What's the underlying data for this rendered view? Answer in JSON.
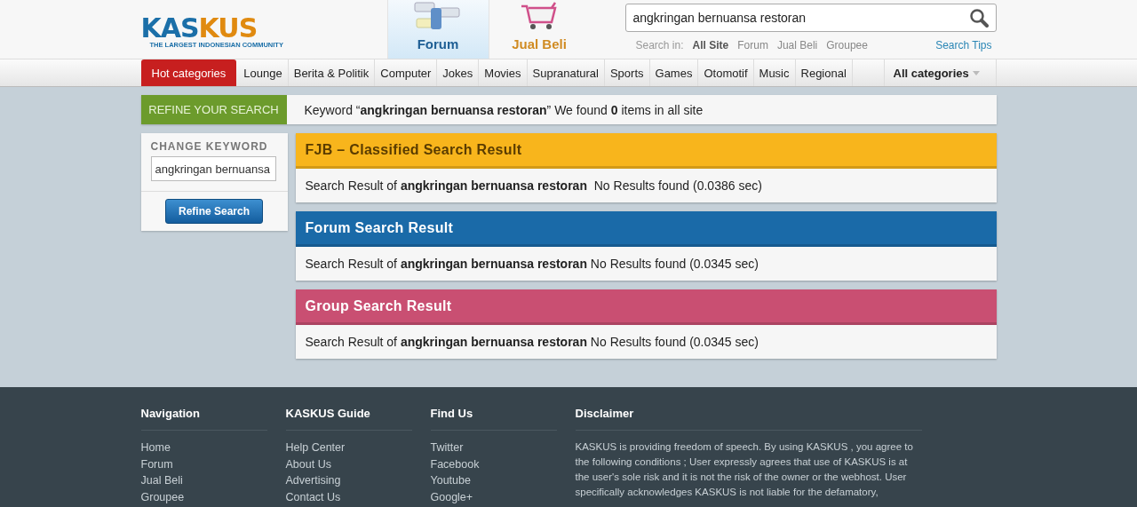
{
  "logo": {
    "name_left": "KAS",
    "name_right": "KUS",
    "tagline": "THE LARGEST INDONESIAN COMMUNITY"
  },
  "sections": [
    {
      "label": "Forum",
      "selected": true,
      "kind": "forum"
    },
    {
      "label": "Jual Beli",
      "selected": false,
      "kind": "cart"
    }
  ],
  "search": {
    "value": "angkringan bernuansa restoran",
    "scope_label": "Search in:",
    "scopes": [
      {
        "label": "All Site",
        "selected": true
      },
      {
        "label": "Forum",
        "selected": false
      },
      {
        "label": "Jual Beli",
        "selected": false
      },
      {
        "label": "Groupee",
        "selected": false
      }
    ],
    "tips": "Search Tips"
  },
  "nav": {
    "hot": "Hot categories",
    "items": [
      "Lounge",
      "Berita & Politik",
      "Computer",
      "Jokes",
      "Movies",
      "Supranatural",
      "Sports",
      "Games",
      "Otomotif",
      "Music",
      "Regional"
    ],
    "all": "All categories"
  },
  "refine": {
    "tab": "REFINE YOUR SEARCH",
    "summary": "Keyword “**angkringan bernuansa restoran**” We found **0** items in all site",
    "change_label": "CHANGE KEYWORD",
    "keyword": "angkringan bernuansa",
    "button": "Refine Search"
  },
  "results": [
    {
      "title": "FJB – Classified Search Result",
      "color": "#f8b51c",
      "text": "Search Result of **angkringan bernuansa restoran**  No Results found (0.0386 sec)"
    },
    {
      "title": "Forum Search Result",
      "color": "#1a6aa8",
      "text": "Search Result of **angkringan bernuansa restoran** No Results found (0.0345 sec)"
    },
    {
      "title": "Group Search Result",
      "color": "#c94f72",
      "text": "Search Result of **angkringan bernuansa restoran** No Results found (0.0345 sec)"
    }
  ],
  "footer": {
    "columns": [
      {
        "title": "Navigation",
        "links": [
          "Home",
          "Forum",
          "Jual Beli",
          "Groupee"
        ]
      },
      {
        "title": "KASKUS Guide",
        "links": [
          "Help Center",
          "About Us",
          "Advertising",
          "Contact Us"
        ]
      },
      {
        "title": "Find Us",
        "links": [
          "Twitter",
          "Facebook",
          "Youtube",
          "Google+"
        ]
      }
    ],
    "disclaimer": {
      "title": "Disclaimer",
      "text": "KASKUS is providing freedom of speech. By using KASKUS , you agree to the following conditions ; User expressly agrees that use of KASKUS is at the user's sole risk and it is not the risk of the owner or the webhost. User specifically acknowledges KASKUS is not liable for the defamatory,"
    }
  }
}
